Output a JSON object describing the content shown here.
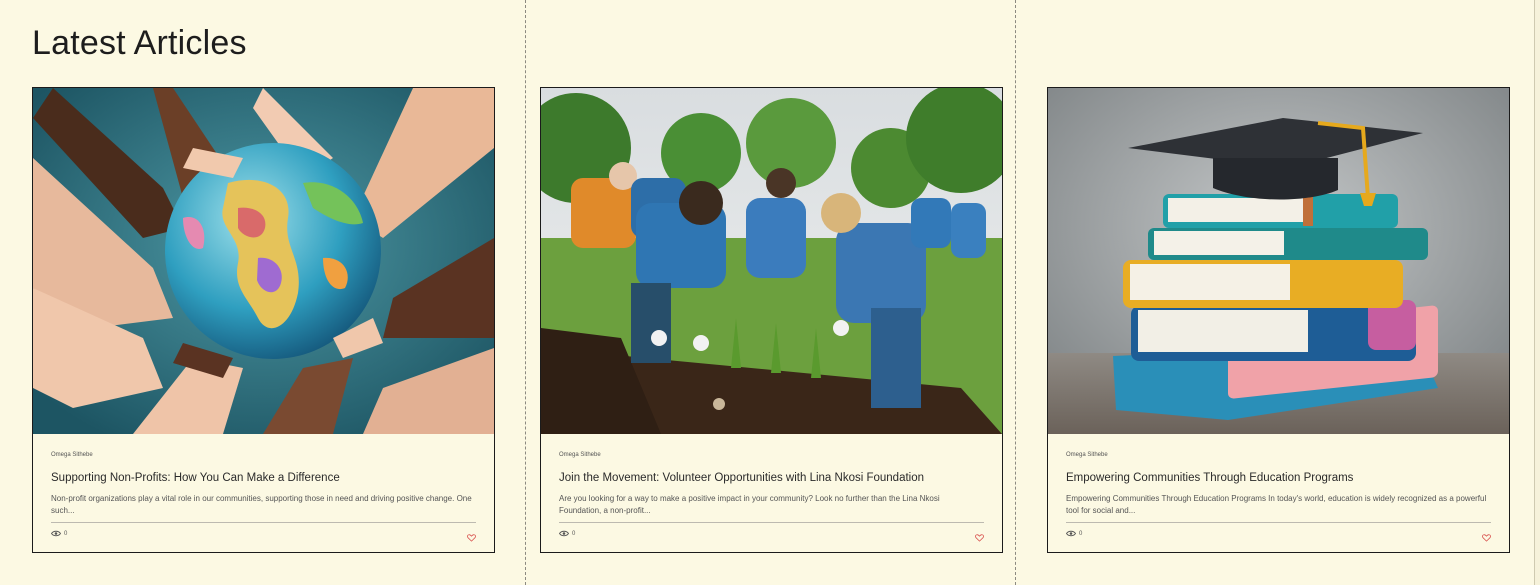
{
  "section": {
    "title": "Latest Articles"
  },
  "colors": {
    "background": "#fcf9e3",
    "accent_heart": "#d9534f",
    "border": "#1b1b1b"
  },
  "articles": [
    {
      "image_alt": "Hands holding a globe",
      "author": "Omega Sithebe",
      "title": "Supporting Non-Profits: How You Can Make a Difference",
      "excerpt": "Non-profit organizations play a vital role in our communities, supporting those in need and driving positive change. One such...",
      "views": "0",
      "icons": {
        "views": "eye-icon",
        "like": "heart-icon"
      }
    },
    {
      "image_alt": "Volunteers planting in a community garden",
      "author": "Omega Sithebe",
      "title": "Join the Movement: Volunteer Opportunities with Lina Nkosi Foundation",
      "excerpt": "Are you looking for a way to make a positive impact in your community? Look no further than the Lina Nkosi Foundation, a non-profit...",
      "views": "0",
      "icons": {
        "views": "eye-icon",
        "like": "heart-icon"
      }
    },
    {
      "image_alt": "Stack of books with a graduation cap",
      "author": "Omega Sithebe",
      "title": "Empowering Communities Through Education Programs",
      "excerpt": "Empowering Communities Through Education Programs In today's world, education is widely recognized as a powerful tool for social and...",
      "views": "0",
      "icons": {
        "views": "eye-icon",
        "like": "heart-icon"
      }
    }
  ]
}
